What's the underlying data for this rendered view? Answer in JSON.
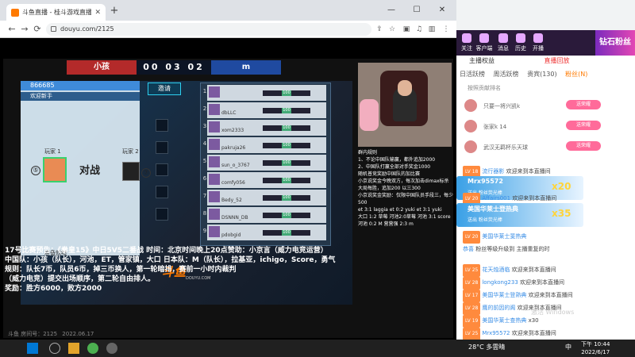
{
  "browser": {
    "tab_title": "斗鱼直播 - 桂斗游戏直播...",
    "url": "douyu.com/2125",
    "window_controls": [
      "—",
      "☐",
      "✕"
    ]
  },
  "stream": {
    "scoreboard": {
      "left_team": "小孩",
      "score": "00 03 02",
      "right_team": "m"
    },
    "room_id": "866685",
    "welcome": "欢迎新手",
    "player1_label": "玩家 1",
    "player2_label": "玩家 2",
    "player1_num": "⑤",
    "player2_num": "⑦",
    "vs": "对战",
    "ready": "准备就绪",
    "invite": "邀请",
    "players": [
      {
        "num": "1",
        "name": "",
        "score": "100"
      },
      {
        "num": "2",
        "name": "dbLLC",
        "score": "100"
      },
      {
        "num": "3",
        "name": "xom2333",
        "score": "100"
      },
      {
        "num": "4",
        "name": "pakruja26",
        "score": "100"
      },
      {
        "num": "5",
        "name": "sun_o_3767",
        "score": "100"
      },
      {
        "num": "6",
        "name": "comfy056",
        "score": "100"
      },
      {
        "num": "7",
        "name": "Bedy_52",
        "score": "100"
      },
      {
        "num": "8",
        "name": "DSNNN_DB",
        "score": "100"
      },
      {
        "num": "9",
        "name": "pdobgid",
        "score": "100"
      }
    ],
    "logo": "斗鱼",
    "logo_sub": "DOUYU.COM",
    "rules_text": [
      "群内规则",
      "1、不论中国队输赢，都外追加2000",
      "2、中国队打赢全部对手奖金1000",
      "随机普竞奖励中国队的加比赛",
      "小京说奖金今晚双方，每次加击dimax标杀",
      "大局每胜，追加200 以三300",
      "小京说奖金奖励：仅限中国队员手段三，每少500",
      "et 3:1 laggia   et 0:2 yuki   et 3:1 yuki",
      "大口 1:2 草莓   河池2:0草莓   河池 3:1 score",
      "河池 0:2 M   营营强 2:3 m"
    ],
    "announcement": [
      "17号比赛预告：《拳皇15》中日5V5二番战 时间：北京时间晚上20点赞助：小京言（威力电竞运营）",
      "中国队：小孩（队长），河池，ET，管家镇，大口  日本队：M（队长），拉基亚，ichigo，Score，勇气",
      "规则：队长7币，队员6币，掉三币换人，第一轮暗排，赛前一小时内裁判",
      "（威力电竞）提交出场顺序，第二轮自由排人。",
      "奖励：胜方6000，败方2000"
    ],
    "footer": [
      "斗鱼 房间号：2125",
      "2022.06.17"
    ]
  },
  "right_panel": {
    "nav": [
      {
        "label": "关注"
      },
      {
        "label": "客户端"
      },
      {
        "label": "消息"
      },
      {
        "label": "历史"
      },
      {
        "label": "开播"
      }
    ],
    "banner": "钻石粉丝",
    "room_title": "主播权益",
    "room_rank": "直播回放",
    "tabs": [
      "日活跃榜",
      "周活跃榜",
      "贵宾(130)",
      "粉丝(N)"
    ],
    "active_tab": "粉丝(N)",
    "rank_header": "按照贡献排名",
    "rank": [
      {
        "name": "只要一将兴凯k",
        "btn": "送荣耀"
      },
      {
        "name": "张家k 14",
        "btn": "送荣耀"
      },
      {
        "name": "武汉无羁杯乐天球",
        "btn": "送荣耀"
      }
    ],
    "chat": [
      {
        "lv": "LV 25",
        "nick": "Mrx95572",
        "text": "欢迎来到本直播间"
      },
      {
        "lv": "LV 18",
        "nick": "流行器影",
        "text": "欢迎来到本直播间"
      },
      {
        "lv": "LV 20",
        "nick": "Affairs001",
        "text": "欢迎来到本直播间"
      },
      {
        "lv": "LV 20",
        "nick": "美国华莱士斐热典",
        "text": ""
      },
      {
        "lv": "",
        "nick": "恭喜",
        "text": "粉丝等级升级到 主播重复的时"
      },
      {
        "lv": "LV 25",
        "nick": "花天烛酒临",
        "text": "欢迎来到本直播间"
      },
      {
        "lv": "LV 28",
        "nick": "longkong233",
        "text": "欢迎来到本直播间"
      },
      {
        "lv": "LV 17",
        "nick": "美国华莱士登熟典",
        "text": "欢迎来到本直播间"
      },
      {
        "lv": "LV 28",
        "nick": "鹰的前因的阁",
        "text": "欢迎来到本直播间"
      },
      {
        "lv": "LV 19",
        "nick": "美国华莱士查热典",
        "text": "x30"
      },
      {
        "lv": "LV 25",
        "nick": "Mrx95572",
        "text": "欢迎来到本直播间"
      }
    ],
    "gifts": [
      {
        "name": "Mrx95572",
        "sub": "送出  粉丝荧光棒",
        "count": "x20"
      },
      {
        "name": "美国华莱士登热典",
        "sub": "送出  粉丝荧光棒",
        "count": "x35"
      }
    ],
    "watermark": "激活 Windows"
  },
  "taskbar": {
    "weather": "28°C 多雲晴",
    "ime": "中",
    "time": "下午 10:44",
    "date": "2022/6/17"
  }
}
